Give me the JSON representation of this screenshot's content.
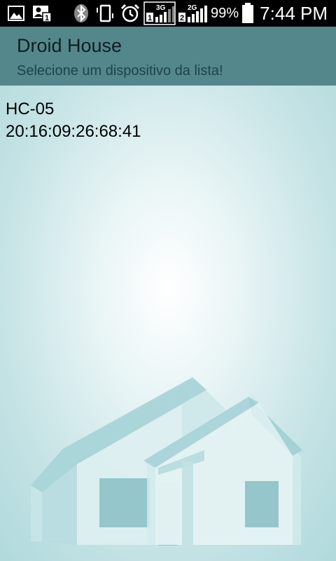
{
  "status_bar": {
    "time": "7:44 PM",
    "battery_percent": "99%",
    "network_1": "3G",
    "network_2": "2G",
    "sim_1": "1",
    "sim_2": "2",
    "icons": [
      "gallery-icon",
      "contact-notification-icon",
      "bluetooth-icon",
      "vibrate-icon",
      "alarm-icon",
      "signal-3g-icon",
      "signal-2g-icon",
      "battery-icon"
    ]
  },
  "app_bar": {
    "title": "Droid House",
    "subtitle": "Selecione um dispositivo da lista!"
  },
  "devices": [
    {
      "name": "HC-05",
      "address": "20:16:09:26:68:41"
    }
  ],
  "colors": {
    "app_bar": "#54878c",
    "background_edge": "#b2dadd",
    "background_center": "#ffffff"
  }
}
